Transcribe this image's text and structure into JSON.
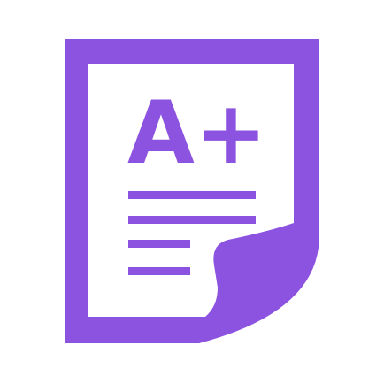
{
  "icon": {
    "name": "graded-document-icon",
    "grade": "A+",
    "colors": {
      "primary": "#8C52E0",
      "background": "#FFFFFF"
    }
  }
}
